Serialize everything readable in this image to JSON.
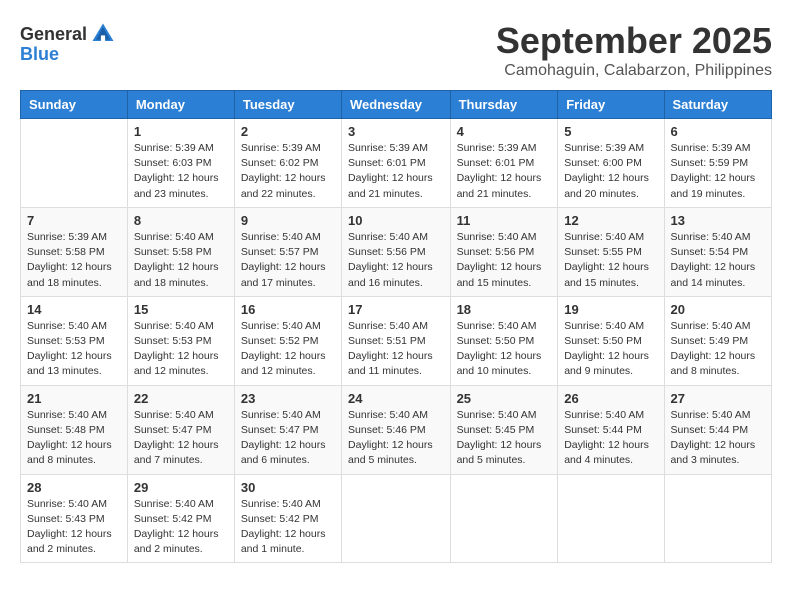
{
  "header": {
    "logo": {
      "general": "General",
      "blue": "Blue"
    },
    "title": "September 2025",
    "location": "Camohaguin, Calabarzon, Philippines"
  },
  "calendar": {
    "headers": [
      "Sunday",
      "Monday",
      "Tuesday",
      "Wednesday",
      "Thursday",
      "Friday",
      "Saturday"
    ],
    "weeks": [
      [
        {
          "day": "",
          "info": ""
        },
        {
          "day": "1",
          "info": "Sunrise: 5:39 AM\nSunset: 6:03 PM\nDaylight: 12 hours\nand 23 minutes."
        },
        {
          "day": "2",
          "info": "Sunrise: 5:39 AM\nSunset: 6:02 PM\nDaylight: 12 hours\nand 22 minutes."
        },
        {
          "day": "3",
          "info": "Sunrise: 5:39 AM\nSunset: 6:01 PM\nDaylight: 12 hours\nand 21 minutes."
        },
        {
          "day": "4",
          "info": "Sunrise: 5:39 AM\nSunset: 6:01 PM\nDaylight: 12 hours\nand 21 minutes."
        },
        {
          "day": "5",
          "info": "Sunrise: 5:39 AM\nSunset: 6:00 PM\nDaylight: 12 hours\nand 20 minutes."
        },
        {
          "day": "6",
          "info": "Sunrise: 5:39 AM\nSunset: 5:59 PM\nDaylight: 12 hours\nand 19 minutes."
        }
      ],
      [
        {
          "day": "7",
          "info": "Sunrise: 5:39 AM\nSunset: 5:58 PM\nDaylight: 12 hours\nand 18 minutes."
        },
        {
          "day": "8",
          "info": "Sunrise: 5:40 AM\nSunset: 5:58 PM\nDaylight: 12 hours\nand 18 minutes."
        },
        {
          "day": "9",
          "info": "Sunrise: 5:40 AM\nSunset: 5:57 PM\nDaylight: 12 hours\nand 17 minutes."
        },
        {
          "day": "10",
          "info": "Sunrise: 5:40 AM\nSunset: 5:56 PM\nDaylight: 12 hours\nand 16 minutes."
        },
        {
          "day": "11",
          "info": "Sunrise: 5:40 AM\nSunset: 5:56 PM\nDaylight: 12 hours\nand 15 minutes."
        },
        {
          "day": "12",
          "info": "Sunrise: 5:40 AM\nSunset: 5:55 PM\nDaylight: 12 hours\nand 15 minutes."
        },
        {
          "day": "13",
          "info": "Sunrise: 5:40 AM\nSunset: 5:54 PM\nDaylight: 12 hours\nand 14 minutes."
        }
      ],
      [
        {
          "day": "14",
          "info": "Sunrise: 5:40 AM\nSunset: 5:53 PM\nDaylight: 12 hours\nand 13 minutes."
        },
        {
          "day": "15",
          "info": "Sunrise: 5:40 AM\nSunset: 5:53 PM\nDaylight: 12 hours\nand 12 minutes."
        },
        {
          "day": "16",
          "info": "Sunrise: 5:40 AM\nSunset: 5:52 PM\nDaylight: 12 hours\nand 12 minutes."
        },
        {
          "day": "17",
          "info": "Sunrise: 5:40 AM\nSunset: 5:51 PM\nDaylight: 12 hours\nand 11 minutes."
        },
        {
          "day": "18",
          "info": "Sunrise: 5:40 AM\nSunset: 5:50 PM\nDaylight: 12 hours\nand 10 minutes."
        },
        {
          "day": "19",
          "info": "Sunrise: 5:40 AM\nSunset: 5:50 PM\nDaylight: 12 hours\nand 9 minutes."
        },
        {
          "day": "20",
          "info": "Sunrise: 5:40 AM\nSunset: 5:49 PM\nDaylight: 12 hours\nand 8 minutes."
        }
      ],
      [
        {
          "day": "21",
          "info": "Sunrise: 5:40 AM\nSunset: 5:48 PM\nDaylight: 12 hours\nand 8 minutes."
        },
        {
          "day": "22",
          "info": "Sunrise: 5:40 AM\nSunset: 5:47 PM\nDaylight: 12 hours\nand 7 minutes."
        },
        {
          "day": "23",
          "info": "Sunrise: 5:40 AM\nSunset: 5:47 PM\nDaylight: 12 hours\nand 6 minutes."
        },
        {
          "day": "24",
          "info": "Sunrise: 5:40 AM\nSunset: 5:46 PM\nDaylight: 12 hours\nand 5 minutes."
        },
        {
          "day": "25",
          "info": "Sunrise: 5:40 AM\nSunset: 5:45 PM\nDaylight: 12 hours\nand 5 minutes."
        },
        {
          "day": "26",
          "info": "Sunrise: 5:40 AM\nSunset: 5:44 PM\nDaylight: 12 hours\nand 4 minutes."
        },
        {
          "day": "27",
          "info": "Sunrise: 5:40 AM\nSunset: 5:44 PM\nDaylight: 12 hours\nand 3 minutes."
        }
      ],
      [
        {
          "day": "28",
          "info": "Sunrise: 5:40 AM\nSunset: 5:43 PM\nDaylight: 12 hours\nand 2 minutes."
        },
        {
          "day": "29",
          "info": "Sunrise: 5:40 AM\nSunset: 5:42 PM\nDaylight: 12 hours\nand 2 minutes."
        },
        {
          "day": "30",
          "info": "Sunrise: 5:40 AM\nSunset: 5:42 PM\nDaylight: 12 hours\nand 1 minute."
        },
        {
          "day": "",
          "info": ""
        },
        {
          "day": "",
          "info": ""
        },
        {
          "day": "",
          "info": ""
        },
        {
          "day": "",
          "info": ""
        }
      ]
    ]
  }
}
